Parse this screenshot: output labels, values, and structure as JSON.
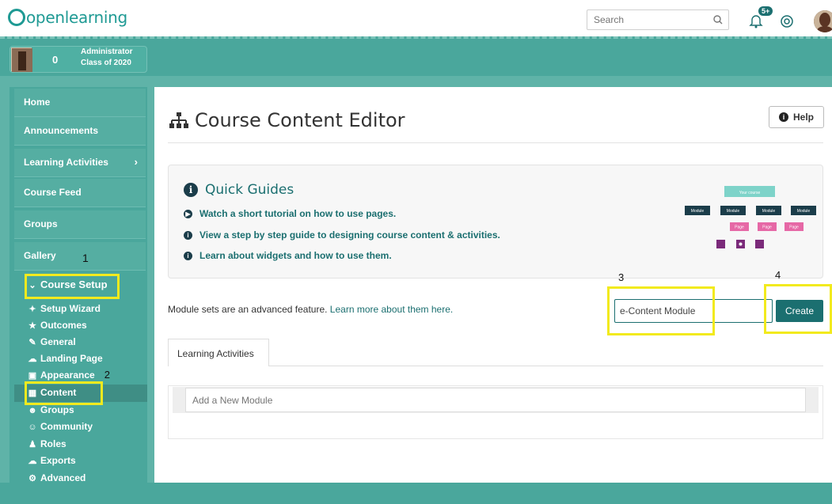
{
  "topbar": {
    "logo_text": "openlearning",
    "search_placeholder": "Search",
    "notif_badge": "5+"
  },
  "user": {
    "count": "0",
    "role": "Administrator",
    "class": "Class of 2020"
  },
  "sidebar": {
    "nav": [
      {
        "label": "Home"
      },
      {
        "label": "Announcements"
      },
      {
        "label": "Learning Activities"
      },
      {
        "label": "Course Feed"
      },
      {
        "label": "Groups"
      },
      {
        "label": "Gallery"
      }
    ],
    "setup_label": "Course Setup",
    "sub_items": [
      {
        "label": "Setup Wizard",
        "icon": "wand-icon"
      },
      {
        "label": "Outcomes",
        "icon": "star-icon"
      },
      {
        "label": "General",
        "icon": "edit-icon"
      },
      {
        "label": "Landing Page",
        "icon": "cloud-icon"
      },
      {
        "label": "Appearance",
        "icon": "image-icon"
      },
      {
        "label": "Content",
        "icon": "sitemap-icon"
      },
      {
        "label": "Groups",
        "icon": "users-icon"
      },
      {
        "label": "Community",
        "icon": "smile-icon"
      },
      {
        "label": "Roles",
        "icon": "user-icon"
      },
      {
        "label": "Exports",
        "icon": "cloud-upload-icon"
      },
      {
        "label": "Advanced",
        "icon": "cogs-icon"
      }
    ]
  },
  "annotations": {
    "one": "1",
    "two": "2",
    "three": "3",
    "four": "4"
  },
  "main": {
    "title": "Course Content Editor",
    "help_label": "Help",
    "guides_title": "Quick Guides",
    "guide_links": [
      "Watch a short tutorial on how to use pages.",
      "View a step by step guide to designing course content & activities.",
      "Learn about widgets and how to use them."
    ],
    "diagram": {
      "root": "Your course",
      "module": "Module",
      "page": "Page"
    },
    "module_note_prefix": "Module sets are an advanced feature. ",
    "module_note_link": "Learn more about them here.",
    "module_input_value": "e-Content Module",
    "create_label": "Create",
    "tab_label": "Learning Activities",
    "add_module_placeholder": "Add a New Module"
  },
  "colors": {
    "teal": "#4aa79c",
    "accent": "#1b6f70",
    "highlight": "#f2ea1e"
  }
}
